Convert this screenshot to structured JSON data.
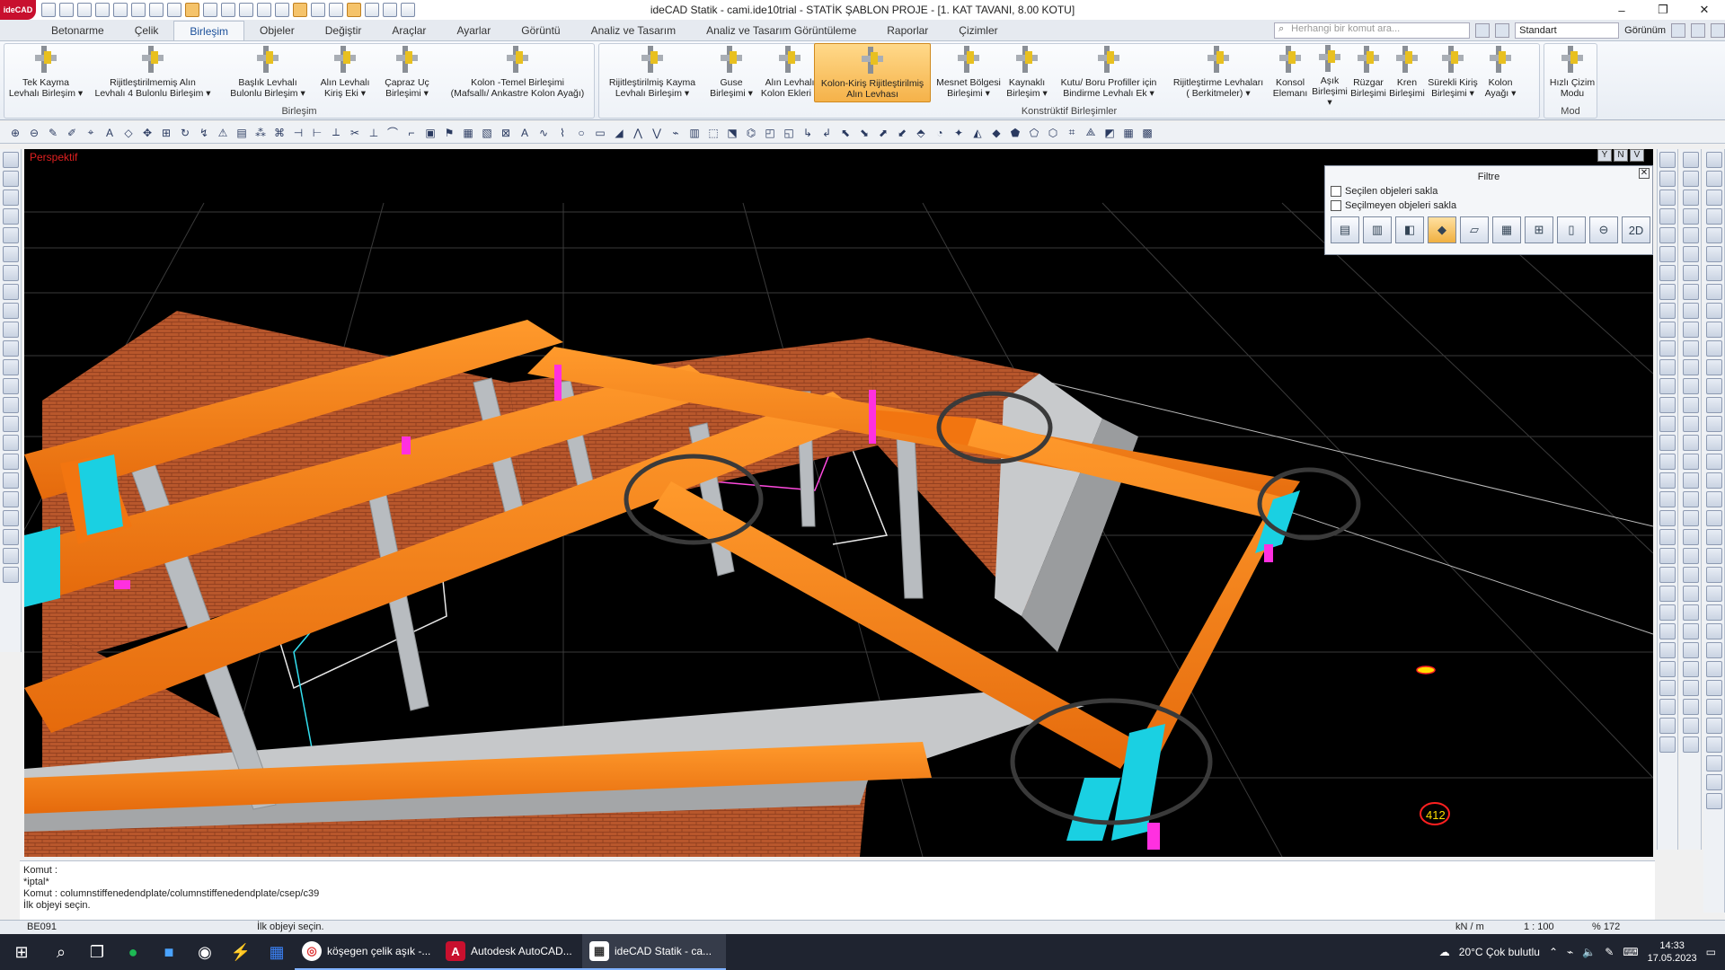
{
  "window": {
    "title": "ideCAD Statik - cami.ide10trial - STATİK ŞABLON PROJE - [1. KAT TAVANI,  8.00 KOTU]",
    "logo": "ideCAD"
  },
  "tabs": [
    {
      "label": "Betonarme"
    },
    {
      "label": "Çelik"
    },
    {
      "label": "Birleşim",
      "active": true
    },
    {
      "label": "Objeler"
    },
    {
      "label": "Değiştir"
    },
    {
      "label": "Araçlar"
    },
    {
      "label": "Ayarlar"
    },
    {
      "label": "Görüntü"
    },
    {
      "label": "Analiz ve Tasarım"
    },
    {
      "label": "Analiz ve Tasarım Görüntüleme"
    },
    {
      "label": "Raporlar"
    },
    {
      "label": "Çizimler"
    }
  ],
  "search": {
    "placeholder": "Herhangi bir komut ara..."
  },
  "style_select": {
    "value": "Standart"
  },
  "view_menu": {
    "label": "Görünüm"
  },
  "ribbon": {
    "group1_label": "Birleşim",
    "group2_label": "Konstrüktif Birleşimler",
    "group3_label": "Mod",
    "buttons": [
      {
        "label1": "Tek Kayma",
        "label2": "Levhalı Birleşim ▾"
      },
      {
        "label1": "Rijitleştirilmemiş Alın",
        "label2": "Levhalı 4 Bulonlu Birleşim ▾"
      },
      {
        "label1": "Başlık Levhalı",
        "label2": "Bulonlu Birleşim ▾"
      },
      {
        "label1": "Alın Levhalı",
        "label2": "Kiriş Eki ▾"
      },
      {
        "label1": "Çapraz Uç",
        "label2": "Birleşimi ▾"
      },
      {
        "label1": "Kolon -Temel Birleşimi",
        "label2": "(Mafsallı/ Ankastre Kolon Ayağı)"
      },
      {
        "label1": "Rijitleştirilmiş Kayma",
        "label2": "Levhalı Birleşim ▾"
      },
      {
        "label1": "Guse",
        "label2": "Birleşimi ▾"
      },
      {
        "label1": "Alın Levhalı",
        "label2": "Kolon Ekleri ▾"
      },
      {
        "label1": "Kolon-Kiriş Rijitleştirilmiş",
        "label2": "Alın Levhası"
      },
      {
        "label1": "Mesnet Bölgesi",
        "label2": "Birleşimi ▾"
      },
      {
        "label1": "Kaynaklı",
        "label2": "Birleşim ▾"
      },
      {
        "label1": "Kutu/ Boru Profiller için",
        "label2": "Bindirme Levhalı Ek ▾"
      },
      {
        "label1": "Rijitleştirme Levhaları",
        "label2": "( Berkitmeler) ▾"
      },
      {
        "label1": "Konsol",
        "label2": "Elemanı"
      },
      {
        "label1": "Aşık",
        "label2": "Birleşimi ▾"
      },
      {
        "label1": "Rüzgar",
        "label2": "Birleşimi"
      },
      {
        "label1": "Kren",
        "label2": "Birleşimi"
      },
      {
        "label1": "Sürekli Kiriş",
        "label2": "Birleşimi ▾"
      },
      {
        "label1": "Kolon",
        "label2": "Ayağı ▾"
      },
      {
        "label1": "Hızlı Çizim",
        "label2": "Modu"
      }
    ]
  },
  "viewport": {
    "label": "Perspektif",
    "view_buttons": [
      "Y",
      "N",
      "V"
    ],
    "colors": {
      "beam": "#f47a14",
      "beam_light": "#ff9a30",
      "column": "#b8bcc0",
      "wall": "#b2532a",
      "connection": "#18d0e0",
      "plate": "#ff30e0",
      "grid": "#3c3c3c",
      "marker": "#333333"
    }
  },
  "filter_panel": {
    "title": "Filtre",
    "option1": "Seçilen objeleri sakla",
    "option2": "Seçilmeyen objeleri sakla",
    "icon_2d": "2D"
  },
  "command": {
    "lines": [
      "Komut :",
      "*iptal*",
      "Komut : columnstiffenedendplate/columnstiffenedendplate/csep/c39",
      "İlk objeyi seçin."
    ]
  },
  "status": {
    "code": "BE091",
    "prompt": "İlk objeyi seçin.",
    "unit": "kN / m",
    "scale": "1 : 100",
    "zoom": "% 172"
  },
  "taskbar": {
    "apps": [
      {
        "label": "köşegen çelik aşık -...",
        "icon": "chrome-icon"
      },
      {
        "label": "Autodesk AutoCAD...",
        "icon": "autocad-icon"
      },
      {
        "label": "ideCAD Statik - ca...",
        "icon": "idecad-icon"
      }
    ],
    "weather": "20°C  Çok bulutlu",
    "time": "14:33",
    "date": "17.05.2023"
  }
}
